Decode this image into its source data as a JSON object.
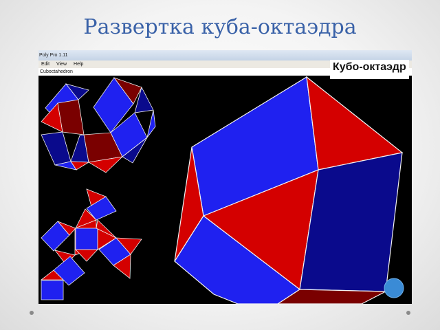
{
  "slide": {
    "title": "Развертка куба-октаэдра"
  },
  "window": {
    "title": "Poly Pro 1.11",
    "menu": {
      "edit": "Edit",
      "view": "View",
      "help": "Help"
    },
    "polyhedron_name": "Cuboctahedron",
    "overlay_label": "Кубо-октаэдр"
  },
  "colors": {
    "square_face": "#1f21f0",
    "triangle_face": "#d40000",
    "shaded_square": "#0a0a8c",
    "shaded_triangle": "#7a0000",
    "sphere": "#3a8bd6",
    "title_blue": "#3a62a8"
  },
  "icons": [
    "bullet-dot-icon",
    "sphere-icon"
  ]
}
